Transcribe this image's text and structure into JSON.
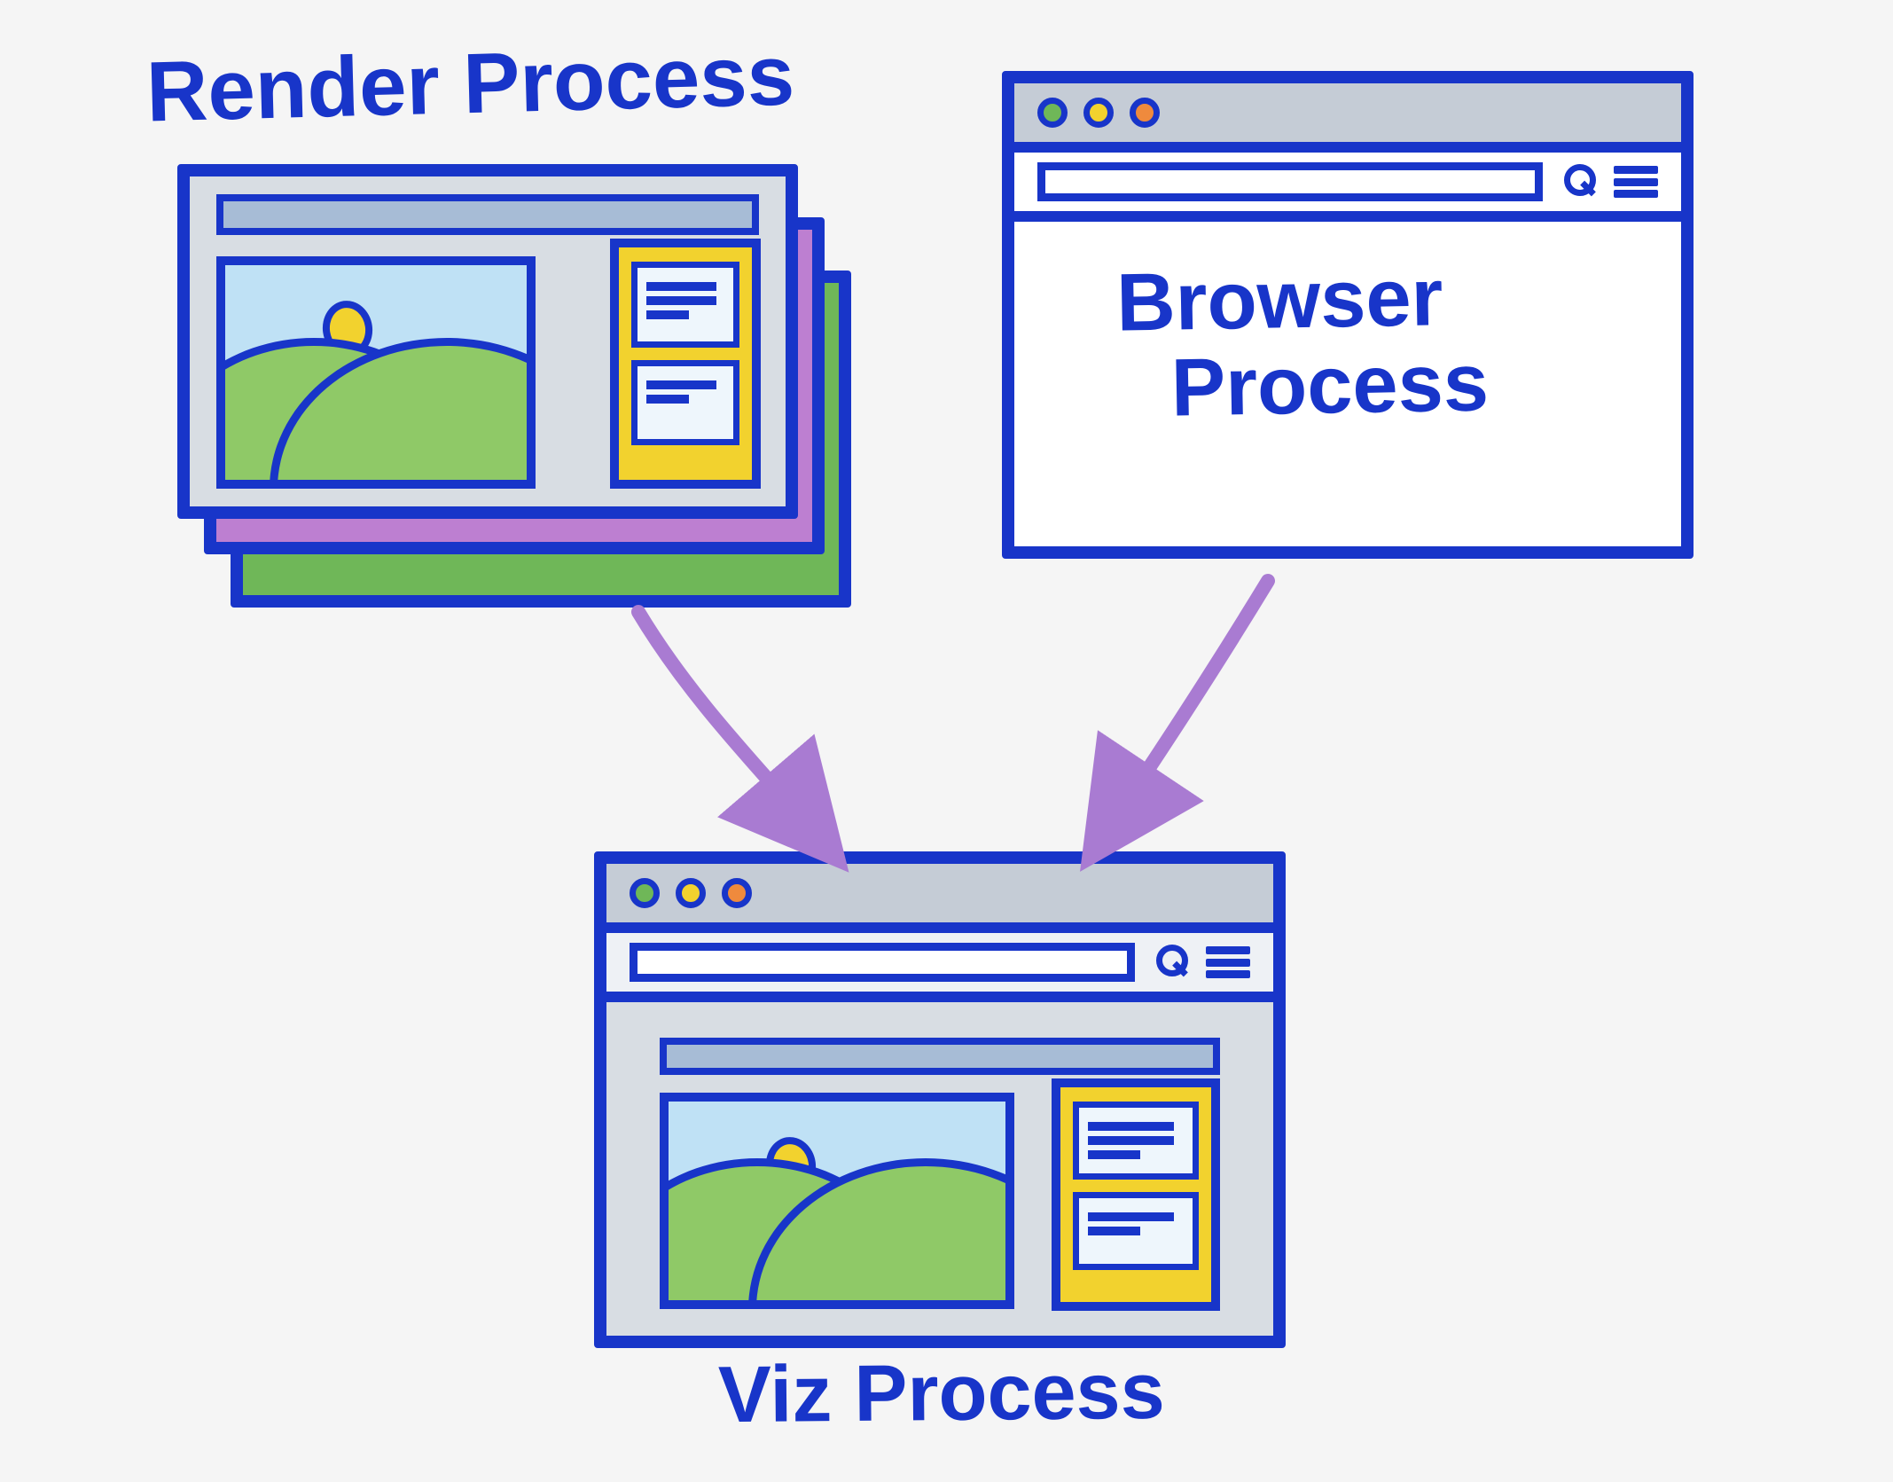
{
  "labels": {
    "render": "Render Process",
    "viz": "Viz Process",
    "browser_line1": "Browser",
    "browser_line2": "Process"
  },
  "diagram": {
    "nodes": [
      {
        "id": "render",
        "label": "Render Process",
        "depicts": "stacked webpage render layers"
      },
      {
        "id": "browser",
        "label": "Browser Process",
        "depicts": "browser chrome window (title bar, address bar, search, menu)"
      },
      {
        "id": "viz",
        "label": "Viz Process",
        "depicts": "browser window showing composited page"
      }
    ],
    "edges": [
      {
        "from": "render",
        "to": "viz"
      },
      {
        "from": "browser",
        "to": "viz"
      }
    ],
    "colors": {
      "stroke": "#1835c9",
      "arrow": "#a97bd2",
      "background": "#f5f5f5",
      "chrome": "#c5ccd6",
      "sky": "#bfe1f5",
      "grass": "#8fc967",
      "sun": "#f2d22e",
      "sidebar": "#f2d22e",
      "stack2": "#bd7fd1",
      "stack3": "#6fb758"
    }
  }
}
